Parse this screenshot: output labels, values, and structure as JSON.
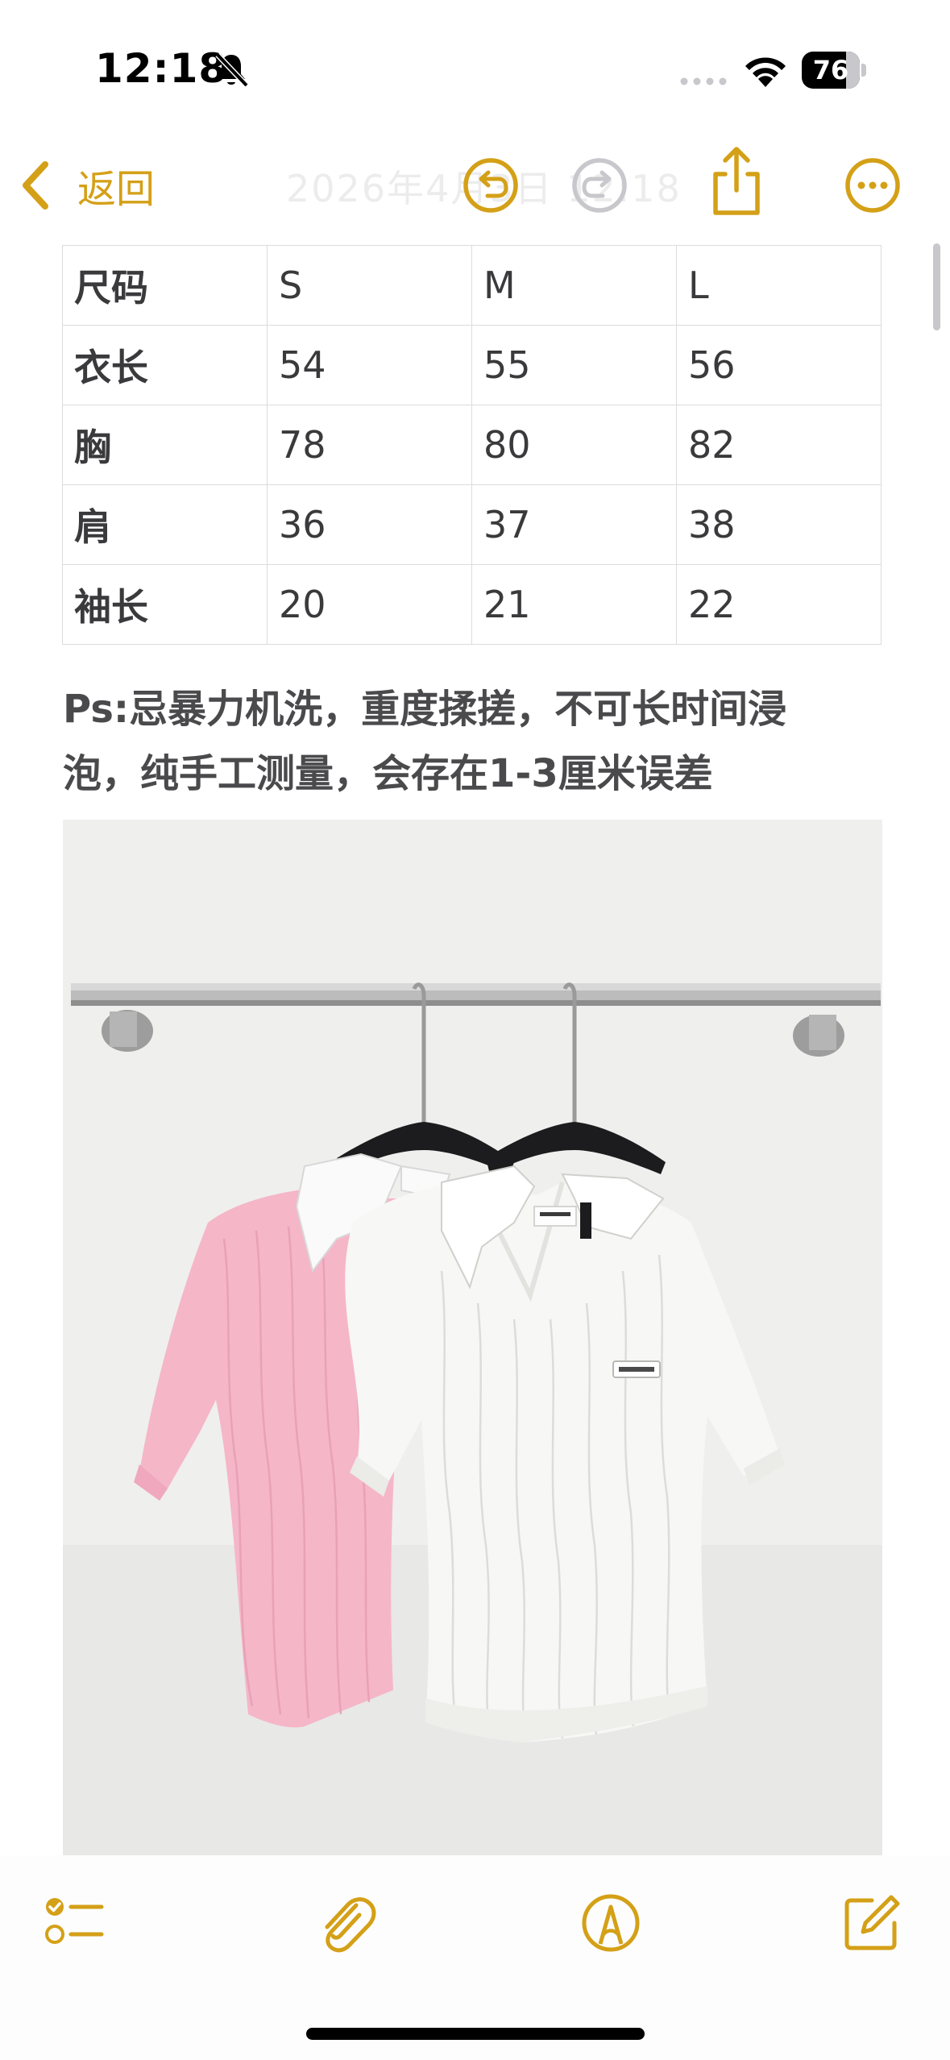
{
  "status_bar": {
    "time": "12:18",
    "battery_level": "76",
    "battery_fraction": 0.76
  },
  "nav": {
    "back_label": "返回",
    "faded_title": "2026年4月3日 12:18",
    "accent_color": "#d4a017"
  },
  "size_table": {
    "rows": [
      [
        "尺码",
        "S",
        "M",
        "L"
      ],
      [
        "衣长",
        "54",
        "55",
        "56"
      ],
      [
        "胸",
        "78",
        "80",
        "82"
      ],
      [
        "肩",
        "36",
        "37",
        "38"
      ],
      [
        "袖长",
        "20",
        "21",
        "22"
      ]
    ]
  },
  "note": {
    "line1": "Ps:忌暴力机洗，重度揉搓，不可长时间浸",
    "line2": "泡，纯手工测量，会存在1-3厘米误差"
  },
  "icons": {
    "nav": [
      "chevron-left-icon",
      "undo-icon",
      "redo-icon",
      "share-icon",
      "more-icon"
    ],
    "toolbar": [
      "checklist-icon",
      "paperclip-icon",
      "markup-icon",
      "compose-icon"
    ],
    "status": [
      "bell-slash-icon",
      "cellular-icon",
      "wifi-icon",
      "battery-icon"
    ]
  },
  "photo_colors": {
    "pink_top": "#f5b6c8",
    "white_top": "#f7f7f5",
    "hanger": "#1c1c1e",
    "rail": "#a8a8a8"
  }
}
